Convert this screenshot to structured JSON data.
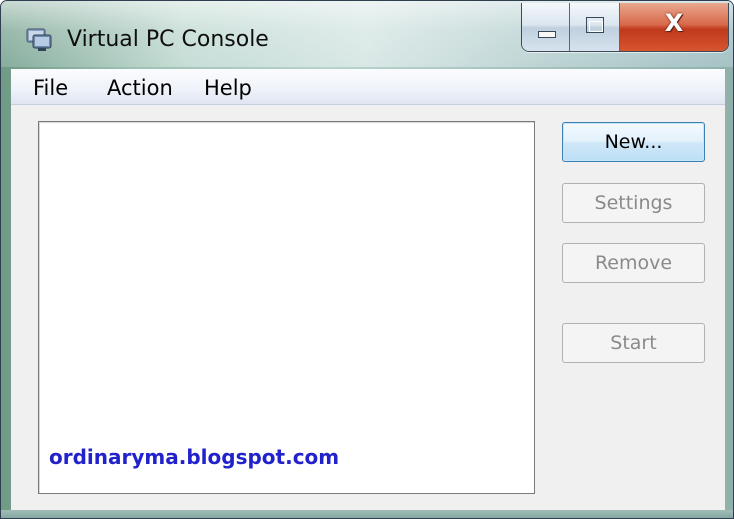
{
  "window": {
    "title": "Virtual PC Console",
    "icon": "virtual-pc-app-icon",
    "caption_buttons": {
      "minimize_icon": "minimize-icon",
      "maximize_icon": "maximize-icon",
      "close_icon": "close-icon",
      "close_glyph": "X"
    }
  },
  "menubar": {
    "items": [
      {
        "label": "File"
      },
      {
        "label": "Action"
      },
      {
        "label": "Help"
      }
    ]
  },
  "vm_list": {
    "items": [],
    "watermark": "ordinaryma.blogspot.com"
  },
  "buttons": {
    "new": {
      "label": "New...",
      "enabled": true
    },
    "settings": {
      "label": "Settings",
      "enabled": false
    },
    "remove": {
      "label": "Remove",
      "enabled": false
    },
    "start": {
      "label": "Start",
      "enabled": false
    }
  },
  "colors": {
    "watermark": "#2222cc",
    "close_button": "#c8402a",
    "focus_button_border": "#3c7fb1",
    "disabled_text": "#8a8a8a"
  }
}
